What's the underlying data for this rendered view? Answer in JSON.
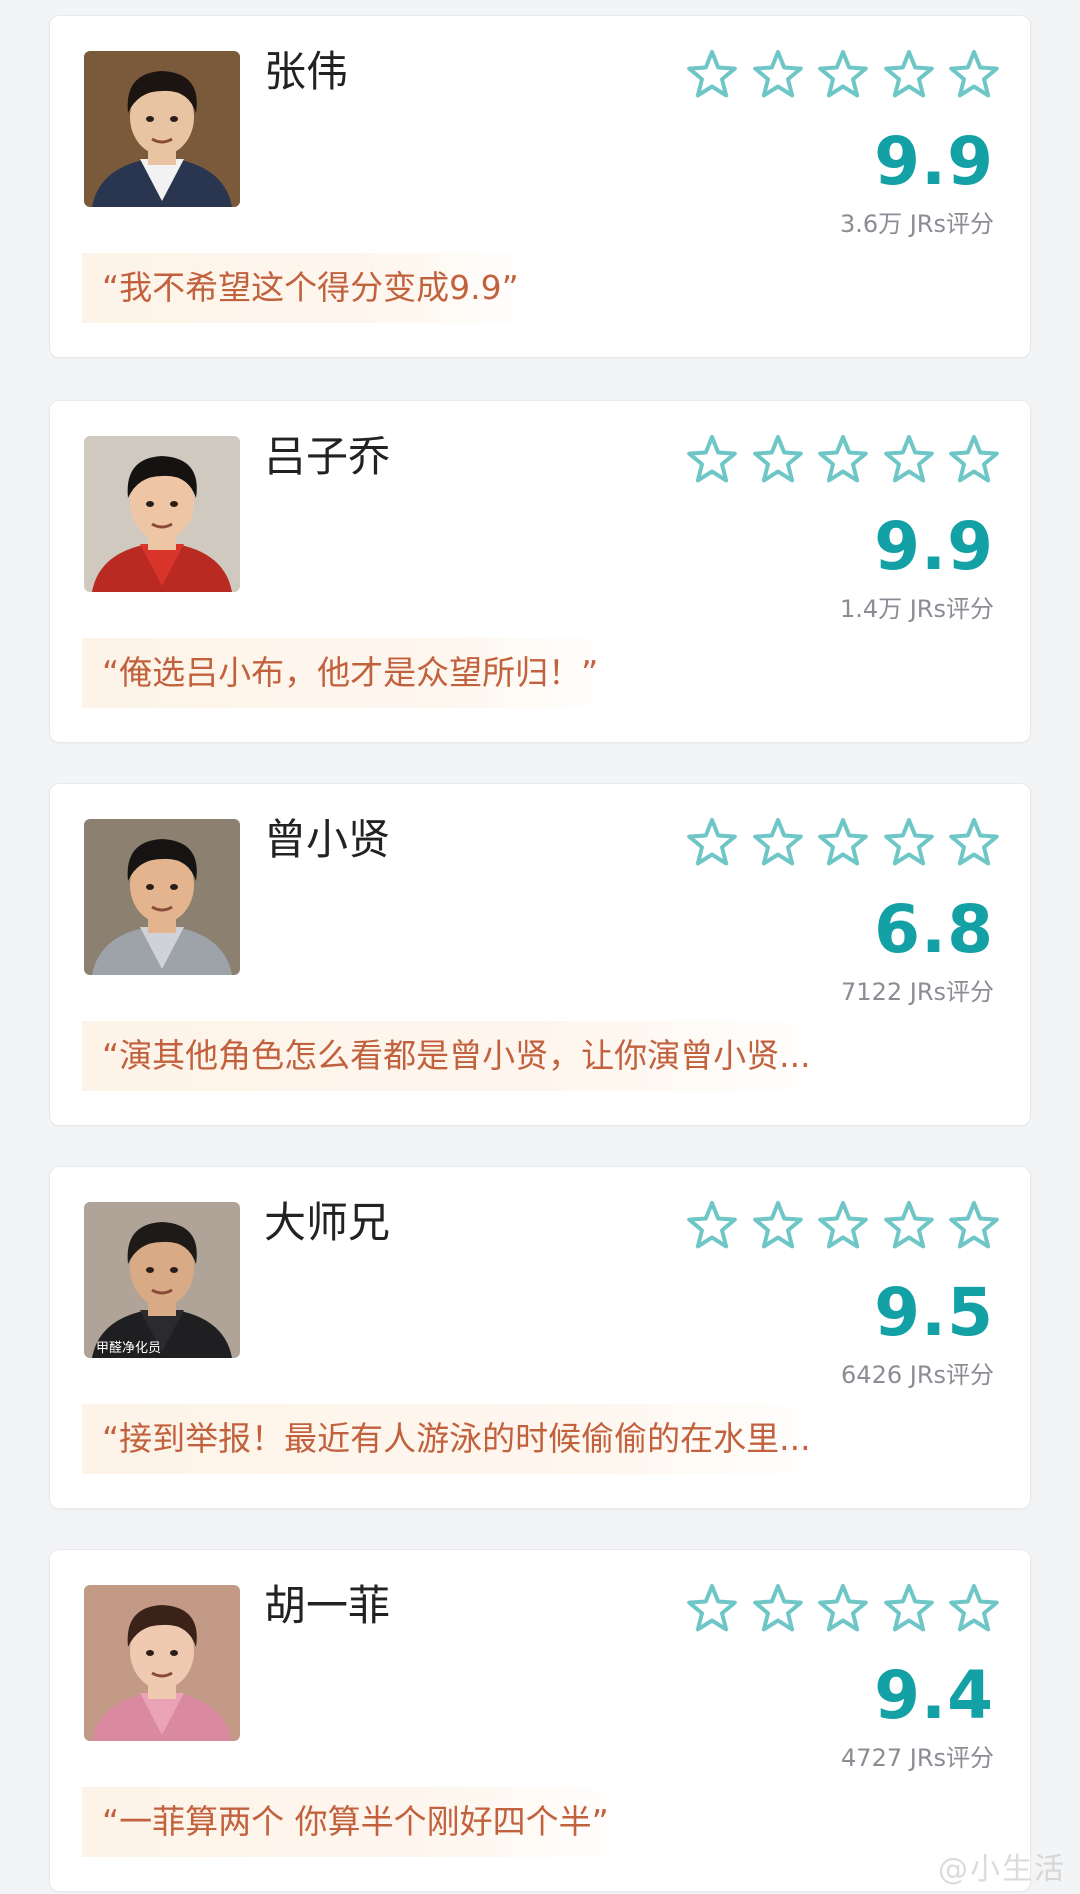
{
  "ratings": [
    {
      "name": "张伟",
      "score": "9.9",
      "count": "3.6万 JRs评分",
      "quote": "“我不希望这个得分变成9.9”",
      "avatar_icon": "person-photo-icon",
      "avatar_colors": {
        "bg": "#7b5a3c",
        "face": "#e8c4a2",
        "hair": "#1b1411",
        "shirt": "#f2f2f2",
        "jacket": "#2a3550"
      }
    },
    {
      "name": "吕子乔",
      "score": "9.9",
      "count": "1.4万 JRs评分",
      "quote": "“俺选吕小布，他才是众望所归！”",
      "avatar_icon": "person-photo-icon",
      "avatar_colors": {
        "bg": "#cfc9c0",
        "face": "#eec6a6",
        "hair": "#151312",
        "shirt": "#d8342a",
        "jacket": "#b82a22"
      }
    },
    {
      "name": "曾小贤",
      "score": "6.8",
      "count": "7122 JRs评分",
      "quote": "“演其他角色怎么看都是曾小贤，让你演曾小贤...",
      "avatar_icon": "person-photo-icon",
      "avatar_colors": {
        "bg": "#8c8070",
        "face": "#e3b48d",
        "hair": "#161412",
        "shirt": "#cfd2d6",
        "jacket": "#9ea3aa"
      }
    },
    {
      "name": "大师兄",
      "score": "9.5",
      "count": "6426 JRs评分",
      "quote": "“接到举报！最近有人游泳的时候偷偷的在水里...",
      "avatar_icon": "person-photo-icon",
      "avatar_colors": {
        "bg": "#b0a398",
        "face": "#d9aa86",
        "hair": "#1d1a18",
        "shirt": "#2b2b2d",
        "jacket": "#1f1f21"
      },
      "avatar_caption": "甲醛净化员"
    },
    {
      "name": "胡一菲",
      "score": "9.4",
      "count": "4727 JRs评分",
      "quote": "“一菲算两个 你算半个刚好四个半”",
      "avatar_icon": "person-photo-icon",
      "avatar_colors": {
        "bg": "#c29a86",
        "face": "#f0c9b1",
        "hair": "#3a2219",
        "shirt": "#e9a3b5",
        "jacket": "#d98aa0"
      }
    }
  ],
  "star_icon": "star-outline-icon",
  "star_count": 5,
  "colors": {
    "score": "#14a1a6",
    "star_stroke": "#6fc6c7",
    "quote_text": "#c2613d",
    "quote_bg": "#fdf3e8"
  },
  "watermark": "@小生活"
}
